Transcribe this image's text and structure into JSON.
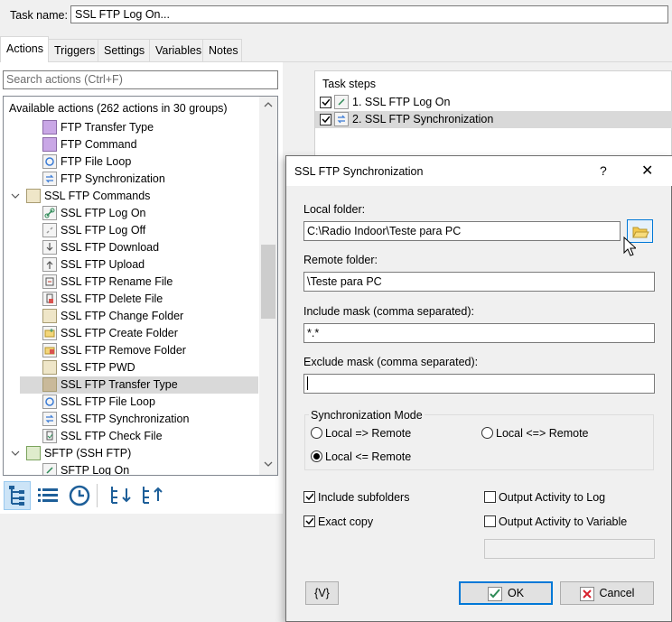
{
  "task": {
    "name_label": "Task name:",
    "name_value": "SSL FTP Log On..."
  },
  "tabs": [
    {
      "label": "Actions",
      "active": true
    },
    {
      "label": "Triggers",
      "active": false
    },
    {
      "label": "Settings",
      "active": false
    },
    {
      "label": "Variables",
      "active": false
    },
    {
      "label": "Notes",
      "active": false
    }
  ],
  "actions_panel": {
    "search_placeholder": "Search actions (Ctrl+F)",
    "header": "Available actions (262 actions in 30 groups)",
    "items": [
      {
        "label": "FTP Transfer Type",
        "icon": "purple-action-icon"
      },
      {
        "label": "FTP Command",
        "icon": "purple-action-icon"
      },
      {
        "label": "FTP File Loop",
        "icon": "loop-icon"
      },
      {
        "label": "FTP Synchronization",
        "icon": "sync-icon"
      },
      {
        "label": "SSL FTP Commands",
        "icon": "folder-icon",
        "group": true
      },
      {
        "label": "SSL FTP Log On",
        "icon": "link-icon"
      },
      {
        "label": "SSL FTP Log Off",
        "icon": "unlink-icon"
      },
      {
        "label": "SSL FTP Download",
        "icon": "download-icon"
      },
      {
        "label": "SSL FTP Upload",
        "icon": "upload-icon"
      },
      {
        "label": "SSL FTP Rename File",
        "icon": "rename-icon"
      },
      {
        "label": "SSL FTP Delete File",
        "icon": "delete-file-icon"
      },
      {
        "label": "SSL FTP Change Folder",
        "icon": "folder-icon"
      },
      {
        "label": "SSL FTP Create Folder",
        "icon": "create-folder-icon"
      },
      {
        "label": "SSL FTP Remove Folder",
        "icon": "remove-folder-icon"
      },
      {
        "label": "SSL FTP PWD",
        "icon": "pwd-icon"
      },
      {
        "label": "SSL FTP Transfer Type",
        "icon": "transfer-type-icon",
        "selected": true
      },
      {
        "label": "SSL FTP File Loop",
        "icon": "loop-icon"
      },
      {
        "label": "SSL FTP Synchronization",
        "icon": "sync-icon"
      },
      {
        "label": "SSL FTP Check File",
        "icon": "check-file-icon"
      },
      {
        "label": "SFTP (SSH FTP)",
        "icon": "folder-green-icon",
        "group": true
      },
      {
        "label": "SFTP Log On",
        "icon": "link-icon"
      }
    ]
  },
  "task_steps": {
    "header": "Task steps",
    "steps": [
      {
        "label": "1. SSL FTP Log On",
        "checked": true
      },
      {
        "label": "2. SSL FTP Synchronization",
        "checked": true,
        "selected": true
      }
    ]
  },
  "dialog": {
    "title": "SSL FTP Synchronization",
    "help": "?",
    "close": "✕",
    "local_folder_label": "Local folder:",
    "local_folder_value": "C:\\Radio Indoor\\Teste para PC",
    "remote_folder_label": "Remote folder:",
    "remote_folder_value": "\\Teste para PC",
    "include_mask_label": "Include mask (comma separated):",
    "include_mask_value": "*.*",
    "exclude_mask_label": "Exclude mask (comma separated):",
    "exclude_mask_value": "",
    "sync_mode_label": "Synchronization Mode",
    "modes": [
      {
        "label": "Local => Remote",
        "selected": false
      },
      {
        "label": "Local <=> Remote",
        "selected": false
      },
      {
        "label": "Local <= Remote",
        "selected": true
      }
    ],
    "include_subfolders": {
      "label": "Include subfolders",
      "checked": true
    },
    "exact_copy": {
      "label": "Exact copy",
      "checked": true
    },
    "output_log": {
      "label": "Output Activity to Log",
      "checked": false
    },
    "output_var": {
      "label": "Output Activity to Variable",
      "checked": false
    },
    "var_button": "{V}",
    "ok_label": "OK",
    "cancel_label": "Cancel"
  }
}
